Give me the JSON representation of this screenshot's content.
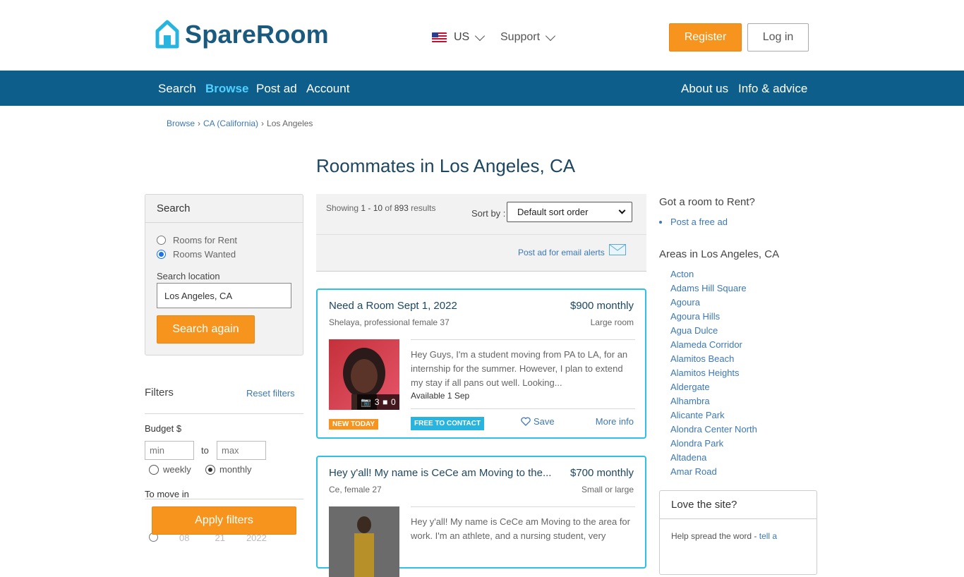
{
  "header": {
    "logo_text": "SpareRoom",
    "locale": "US",
    "support": "Support",
    "register": "Register",
    "login": "Log in"
  },
  "nav": {
    "left": [
      "Search",
      "Browse",
      "Post ad",
      "Account"
    ],
    "right": [
      "About us",
      "Info & advice"
    ],
    "active": "Browse"
  },
  "breadcrumb": [
    "Browse",
    "CA (California)",
    "Los Angeles"
  ],
  "page_title": "Roommates in Los Angeles, CA",
  "search_panel": {
    "title": "Search",
    "option_rent": "Rooms for Rent",
    "option_wanted": "Rooms Wanted",
    "selected": "Rooms Wanted",
    "location_label": "Search location",
    "location_value": "Los Angeles, CA",
    "button": "Search again"
  },
  "filters": {
    "title": "Filters",
    "reset": "Reset filters",
    "budget_label": "Budget $",
    "min_placeholder": "min",
    "max_placeholder": "max",
    "to": "to",
    "weekly": "weekly",
    "monthly": "monthly",
    "selected_period": "monthly",
    "move_in_label": "To move in",
    "date_month": "08",
    "date_day": "21",
    "date_year": "2022",
    "apply": "Apply filters"
  },
  "results": {
    "showing_prefix": "Showing",
    "range": "1 - 10",
    "of": "of",
    "total": "893",
    "suffix": "results",
    "sort_label": "Sort by :",
    "sort_value": "Default sort order",
    "email_alerts": "Post ad for email alerts"
  },
  "listings": [
    {
      "title": "Need a Room Sept 1, 2022",
      "price": "$900 monthly",
      "poster": "Shelaya, professional female 37",
      "room_type": "Large room",
      "photos": "3",
      "videos": "0",
      "description": "Hey Guys, I'm a student moving from PA to LA, for an internship for the summer. However, I plan to extend my stay if all pans out well. Looking...",
      "available": "Available 1 Sep",
      "badge_new": "NEW TODAY",
      "badge_free": "FREE TO CONTACT",
      "save": "Save",
      "more": "More info"
    },
    {
      "title": "Hey y'all! My name is CeCe am Moving to the...",
      "price": "$700 monthly",
      "poster": "Ce, female 27",
      "room_type": "Small or large",
      "description": "Hey y'all! My name is CeCe am Moving to the area for work. I'm an athlete, and a nursing student, very"
    }
  ],
  "sidebar": {
    "got_room": "Got a room to Rent?",
    "post_free": "Post a free ad",
    "areas_title": "Areas in Los Angeles, CA",
    "areas": [
      "Acton",
      "Adams Hill Square",
      "Agoura",
      "Agoura Hills",
      "Agua Dulce",
      "Alameda Corridor",
      "Alamitos Beach",
      "Alamitos Heights",
      "Aldergate",
      "Alhambra",
      "Alicante Park",
      "Alondra Center North",
      "Alondra Park",
      "Altadena",
      "Amar Road"
    ],
    "love_title": "Love the site?",
    "love_text": "Help spread the word -",
    "love_link": "tell a"
  },
  "colors": {
    "nav_bg": "#0d5e8a",
    "accent_orange": "#f7941d",
    "card_border": "#2ec1e8",
    "link_blue": "#3c78b4",
    "active_nav": "#4fd1ff"
  }
}
